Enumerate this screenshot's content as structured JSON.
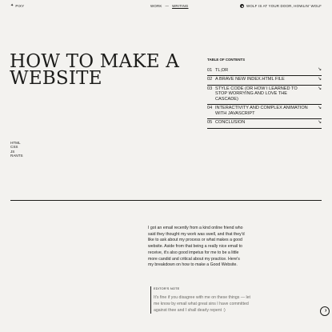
{
  "header": {
    "brand": "PIXY",
    "brand_icon": "star-icon",
    "nav": [
      {
        "label": "WORK",
        "active": false
      },
      {
        "label": "—",
        "active": false
      },
      {
        "label": "WRITING",
        "active": true
      }
    ],
    "status_text": "WOLF IS AT YOUR DOOR, HOWLIN' WOLF",
    "status_icon": "record-icon"
  },
  "article": {
    "title_lines": [
      "HOW TO MAKE A",
      "WEBSITE"
    ],
    "tags": [
      "HTML",
      "CSS",
      "JS",
      "RANTS"
    ]
  },
  "toc": {
    "heading": "TABLE OF CONTENTS",
    "items": [
      {
        "num": "01",
        "label": "TL;DR"
      },
      {
        "num": "02",
        "label": "A BRAVE NEW INDEX.HTML FILE"
      },
      {
        "num": "03",
        "label": "STYLE CODE (OR HOW I LEARNED TO STOP WORRYING AND LOVE THE CASCADE)"
      },
      {
        "num": "04",
        "label": "INTERACTIVITY AND COMPLEX ANIMATION WITH JAVASCRIPT"
      },
      {
        "num": "05",
        "label": "CONCLUSION"
      }
    ],
    "arrow": "↘"
  },
  "body": {
    "intro": "I got an email recently from a kind online friend who said they thought my work was swell, and that they'd like to ask about my process or what makes a good website. Aside from that being a really nice email to receive, it's also good impetus for me to be a little more candid and critical about my practice. Here's my breakdown on how to make a Good Website.",
    "note_label": "EDITOR'S NOTE",
    "note_text": "It's fine if you disagree with me on these things — let me know by email what great sins I have committed against thee and I shall dearly repent :)"
  }
}
